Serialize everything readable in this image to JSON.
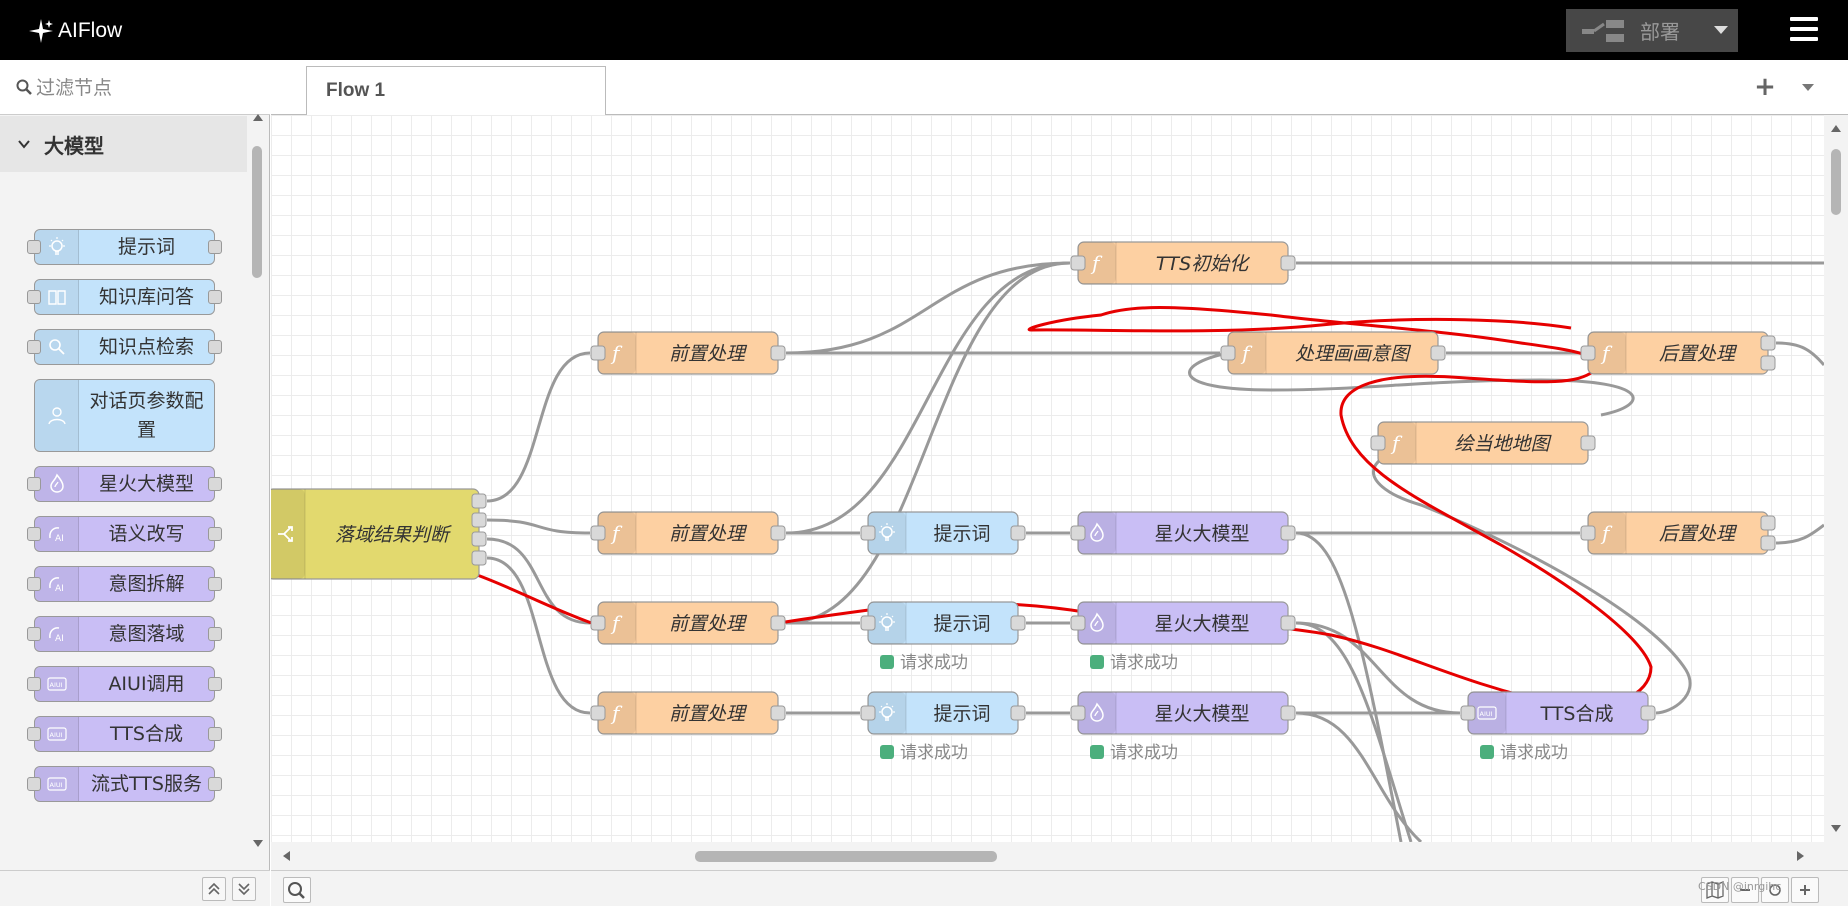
{
  "app": {
    "title": "AIFlow"
  },
  "header": {
    "deploy_label": "部署"
  },
  "sidebar": {
    "filter_placeholder": "过滤节点",
    "category": "大模型",
    "items": [
      {
        "label": "提示词",
        "color": "#c3e3fb",
        "icon": "bulb-icon"
      },
      {
        "label": "知识库问答",
        "color": "#c3e3fb",
        "icon": "book-icon"
      },
      {
        "label": "知识点检索",
        "color": "#c3e3fb",
        "icon": "search-icon"
      },
      {
        "label": "对话页参数配置",
        "color": "#c3e3fb",
        "icon": "user-icon"
      },
      {
        "label": "星火大模型",
        "color": "#c9bef5",
        "icon": "spark-icon"
      },
      {
        "label": "语义改写",
        "color": "#c9bef5",
        "icon": "ai-icon"
      },
      {
        "label": "意图拆解",
        "color": "#c9bef5",
        "icon": "ai-icon"
      },
      {
        "label": "意图落域",
        "color": "#c9bef5",
        "icon": "ai-icon"
      },
      {
        "label": "AIUI调用",
        "color": "#c9bef5",
        "icon": "aiui-icon"
      },
      {
        "label": "TTS合成",
        "color": "#c9bef5",
        "icon": "aiui-icon"
      },
      {
        "label": "流式TTS服务",
        "color": "#c9bef5",
        "icon": "aiui-icon"
      }
    ]
  },
  "tabs": [
    {
      "label": "Flow 1"
    }
  ],
  "canvas": {
    "nodes": [
      {
        "id": "switch",
        "label": "落域结果判断",
        "type": "switch"
      },
      {
        "id": "pre1",
        "label": "前置处理",
        "type": "function"
      },
      {
        "id": "pre2",
        "label": "前置处理",
        "type": "function"
      },
      {
        "id": "pre3",
        "label": "前置处理",
        "type": "function"
      },
      {
        "id": "pre4",
        "label": "前置处理",
        "type": "function"
      },
      {
        "id": "ttsinit",
        "label": "TTS初始化",
        "type": "function"
      },
      {
        "id": "draw",
        "label": "处理画画意图",
        "type": "function"
      },
      {
        "id": "post1",
        "label": "后置处理",
        "type": "function"
      },
      {
        "id": "map",
        "label": "绘当地地图",
        "type": "function"
      },
      {
        "id": "post2",
        "label": "后置处理",
        "type": "function"
      },
      {
        "id": "prompt1",
        "label": "提示词",
        "type": "prompt"
      },
      {
        "id": "prompt2",
        "label": "提示词",
        "type": "prompt"
      },
      {
        "id": "prompt3",
        "label": "提示词",
        "type": "prompt"
      },
      {
        "id": "spark1",
        "label": "星火大模型",
        "type": "spark"
      },
      {
        "id": "spark2",
        "label": "星火大模型",
        "type": "spark"
      },
      {
        "id": "spark3",
        "label": "星火大模型",
        "type": "spark"
      },
      {
        "id": "tts",
        "label": "TTS合成",
        "type": "tts"
      }
    ],
    "status_text": "请求成功",
    "status_color": "#4caf7d",
    "colors": {
      "function": "#fdd0a2",
      "prompt": "#c3e3fb",
      "spark": "#c9bef5",
      "switch": "#e2d96e",
      "wire": "#999999",
      "annotation": "#e60000"
    }
  },
  "watermark": "CSDN @inrgihc"
}
